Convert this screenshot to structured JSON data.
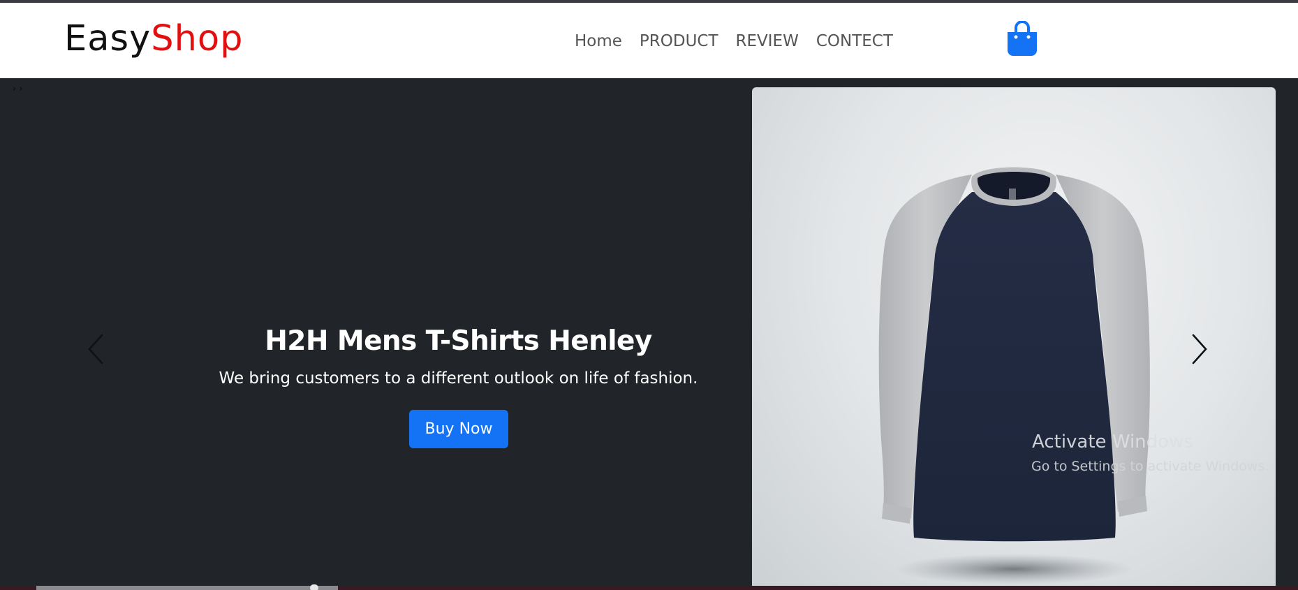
{
  "brand": {
    "part1": "Easy",
    "part2": "Shop",
    "color1": "#111111",
    "color2": "#e01010"
  },
  "nav": {
    "items": [
      "Home",
      "PRODUCT",
      "REVIEW",
      "CONTECT"
    ]
  },
  "cart": {
    "icon": "shopping-bag-icon",
    "color": "#1473f5"
  },
  "breadcrumb": {
    "text": "› ›"
  },
  "hero": {
    "title": "H2H Mens T-Shirts Henley",
    "subtitle": "We bring customers to a different outlook on life of fashion.",
    "cta": "Buy Now",
    "accent": "#1473f5",
    "background": "#212429",
    "prev_icon": "chevron-left-icon",
    "next_icon": "chevron-right-icon"
  },
  "product_image": {
    "icon": "long-sleeve-raglan-tshirt"
  },
  "watermark": {
    "title": "Activate Windows",
    "subtitle": "Go to Settings to activate Windows."
  }
}
